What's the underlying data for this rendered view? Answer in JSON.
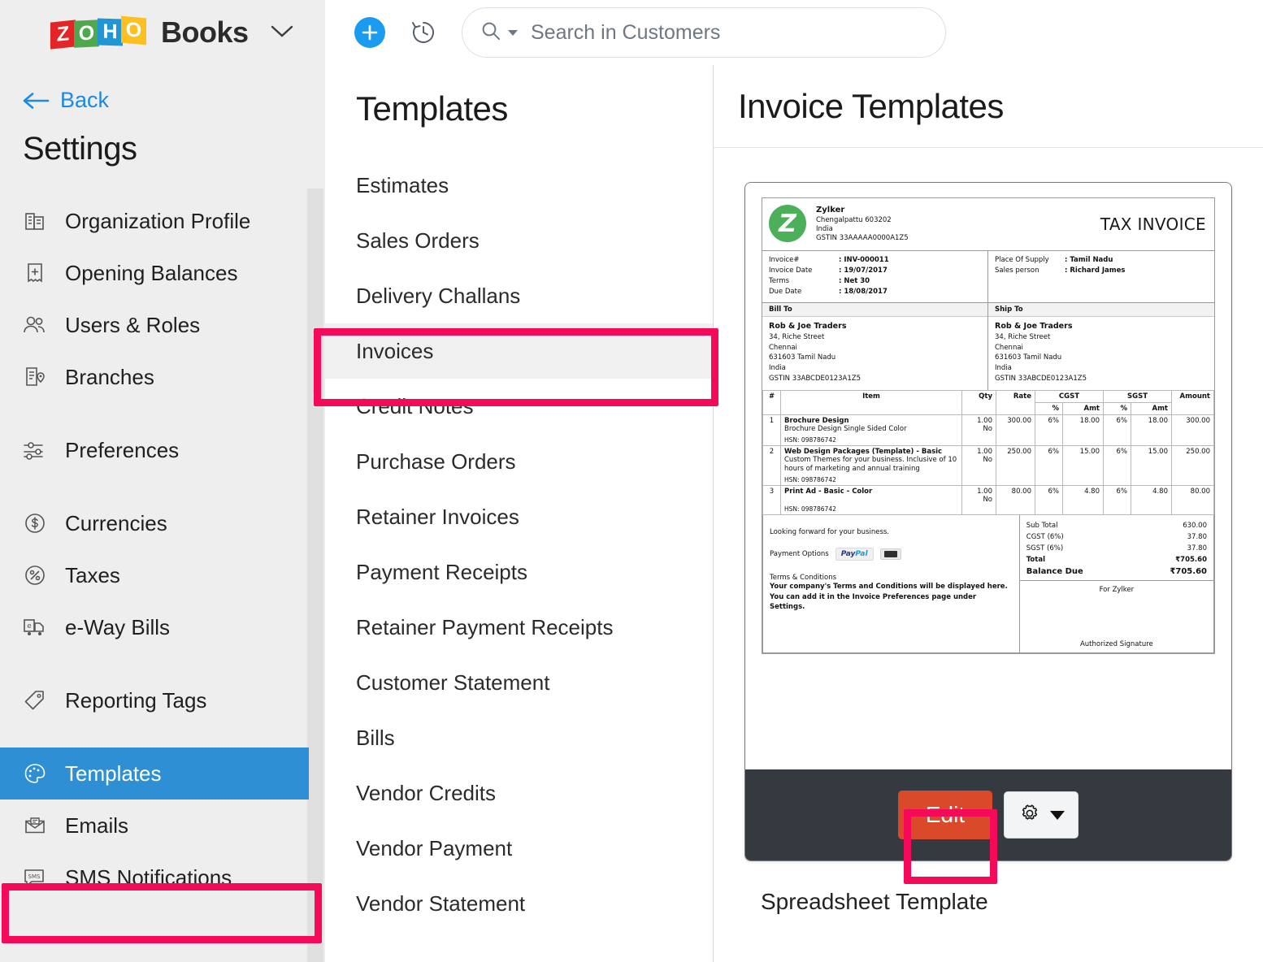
{
  "brand": {
    "logo_letters": [
      "Z",
      "O",
      "H",
      "O"
    ],
    "product": "Books",
    "colors": {
      "z": "#e42527",
      "o1": "#4fa94c",
      "h": "#2196d4",
      "o2": "#fdc020"
    }
  },
  "topbar": {
    "new_label": "+",
    "history_label": "Recent Activities",
    "search": {
      "placeholder": "Search in Customers",
      "value": ""
    }
  },
  "sidebar": {
    "back_label": "Back",
    "title": "Settings",
    "groups": [
      {
        "items": [
          {
            "label": "Organization Profile",
            "icon": "building-icon",
            "active": false
          },
          {
            "label": "Opening Balances",
            "icon": "receipt-plus-icon",
            "active": false
          },
          {
            "label": "Users & Roles",
            "icon": "users-icon",
            "active": false
          },
          {
            "label": "Branches",
            "icon": "branch-pin-icon",
            "active": false
          }
        ]
      },
      {
        "items": [
          {
            "label": "Preferences",
            "icon": "sliders-icon",
            "active": false
          }
        ]
      },
      {
        "items": [
          {
            "label": "Currencies",
            "icon": "dollar-circle-icon",
            "active": false
          },
          {
            "label": "Taxes",
            "icon": "percent-circle-icon",
            "active": false
          },
          {
            "label": "e-Way Bills",
            "icon": "eway-truck-icon",
            "active": false
          }
        ]
      },
      {
        "items": [
          {
            "label": "Reporting Tags",
            "icon": "tag-icon",
            "active": false
          }
        ]
      },
      {
        "items": [
          {
            "label": "Templates",
            "icon": "palette-icon",
            "active": true
          },
          {
            "label": "Emails",
            "icon": "envelope-icon",
            "active": false
          },
          {
            "label": "SMS Notifications",
            "icon": "sms-icon",
            "active": false
          }
        ]
      }
    ]
  },
  "templates_column": {
    "title": "Templates",
    "items": [
      {
        "label": "Estimates",
        "selected": false
      },
      {
        "label": "Sales Orders",
        "selected": false
      },
      {
        "label": "Delivery Challans",
        "selected": false
      },
      {
        "label": "Invoices",
        "selected": true
      },
      {
        "label": "Credit Notes",
        "selected": false
      },
      {
        "label": "Purchase Orders",
        "selected": false
      },
      {
        "label": "Retainer Invoices",
        "selected": false
      },
      {
        "label": "Payment Receipts",
        "selected": false
      },
      {
        "label": "Retainer Payment Receipts",
        "selected": false
      },
      {
        "label": "Customer Statement",
        "selected": false
      },
      {
        "label": "Bills",
        "selected": false
      },
      {
        "label": "Vendor Credits",
        "selected": false
      },
      {
        "label": "Vendor Payment",
        "selected": false
      },
      {
        "label": "Vendor Statement",
        "selected": false
      }
    ]
  },
  "main": {
    "title": "Invoice Templates",
    "card": {
      "caption": "Spreadsheet Template",
      "edit_label": "Edit",
      "settings_icon": "gear-icon"
    }
  },
  "invoice_preview": {
    "doc_type": "TAX INVOICE",
    "org": {
      "logo_letter": "Z",
      "logo_color": "#4cb05a",
      "name": "Zylker",
      "address_line": "Chengalpattu  603202",
      "country": "India",
      "gstin": "GSTIN 33AAAAA0000A1Z5"
    },
    "meta_left": [
      {
        "key": "Invoice#",
        "value": ": INV-000011"
      },
      {
        "key": "Invoice Date",
        "value": ": 19/07/2017"
      },
      {
        "key": "Terms",
        "value": ": Net 30"
      },
      {
        "key": "Due Date",
        "value": ": 18/08/2017"
      }
    ],
    "meta_right": [
      {
        "key": "Place Of Supply",
        "value": ": Tamil Nadu"
      },
      {
        "key": "Sales person",
        "value": ": Richard James"
      }
    ],
    "bill_to": {
      "heading": "Bill To",
      "name": "Rob & Joe Traders",
      "lines": [
        "34, Riche Street",
        "Chennai",
        "631603 Tamil Nadu",
        "India",
        "GSTIN 33ABCDE0123A1Z5"
      ]
    },
    "ship_to": {
      "heading": "Ship To",
      "name": "Rob & Joe Traders",
      "lines": [
        "34, Riche Street",
        "Chennai",
        "631603 Tamil Nadu",
        "India",
        "GSTIN 33ABCDE0123A1Z5"
      ]
    },
    "table": {
      "group_headers": [
        "CGST",
        "SGST"
      ],
      "headers": [
        "#",
        "Item",
        "Qty",
        "Rate",
        "%",
        "Amt",
        "%",
        "Amt",
        "Amount"
      ],
      "rows": [
        {
          "no": "1",
          "item": "Brochure Design",
          "desc": "Brochure Design Single Sided Color",
          "hsn": "HSN: 098786742",
          "qty": "1.00",
          "unit": "No",
          "rate": "300.00",
          "cgst_pct": "6%",
          "cgst_amt": "18.00",
          "sgst_pct": "6%",
          "sgst_amt": "18.00",
          "amount": "300.00"
        },
        {
          "no": "2",
          "item": "Web Design Packages (Template) - Basic",
          "desc": "Custom Themes for your business. Inclusive of 10 hours of marketing and annual training",
          "hsn": "HSN: 098786742",
          "qty": "1.00",
          "unit": "No",
          "rate": "250.00",
          "cgst_pct": "6%",
          "cgst_amt": "15.00",
          "sgst_pct": "6%",
          "sgst_amt": "15.00",
          "amount": "250.00"
        },
        {
          "no": "3",
          "item": "Print Ad - Basic - Color",
          "desc": "",
          "hsn": "HSN: 098786742",
          "qty": "1.00",
          "unit": "No",
          "rate": "80.00",
          "cgst_pct": "6%",
          "cgst_amt": "4.80",
          "sgst_pct": "6%",
          "sgst_amt": "4.80",
          "amount": "80.00"
        }
      ]
    },
    "footer": {
      "thanks": "Looking forward for your business.",
      "payment_label": "Payment Options",
      "payment_methods": [
        "PayPal",
        "card-icon"
      ],
      "terms_heading": "Terms & Conditions",
      "terms_body": "Your company's Terms and Conditions will be displayed here. You can add it in the Invoice Preferences page under Settings.",
      "totals": [
        {
          "label": "Sub Total",
          "value": "630.00",
          "bold": false
        },
        {
          "label": "CGST (6%)",
          "value": "37.80",
          "bold": false
        },
        {
          "label": "SGST (6%)",
          "value": "37.80",
          "bold": false
        },
        {
          "label": "Total",
          "value": "₹705.60",
          "bold": true
        },
        {
          "label": "Balance Due",
          "value": "₹705.60",
          "bold": true
        }
      ],
      "for_org": "For Zylker",
      "authorized": "Authorized Signature"
    }
  },
  "annotations": {
    "color": "#f50a5a",
    "targets": [
      "invoices-menu-item",
      "templates-sidebar-item",
      "edit-button"
    ]
  }
}
